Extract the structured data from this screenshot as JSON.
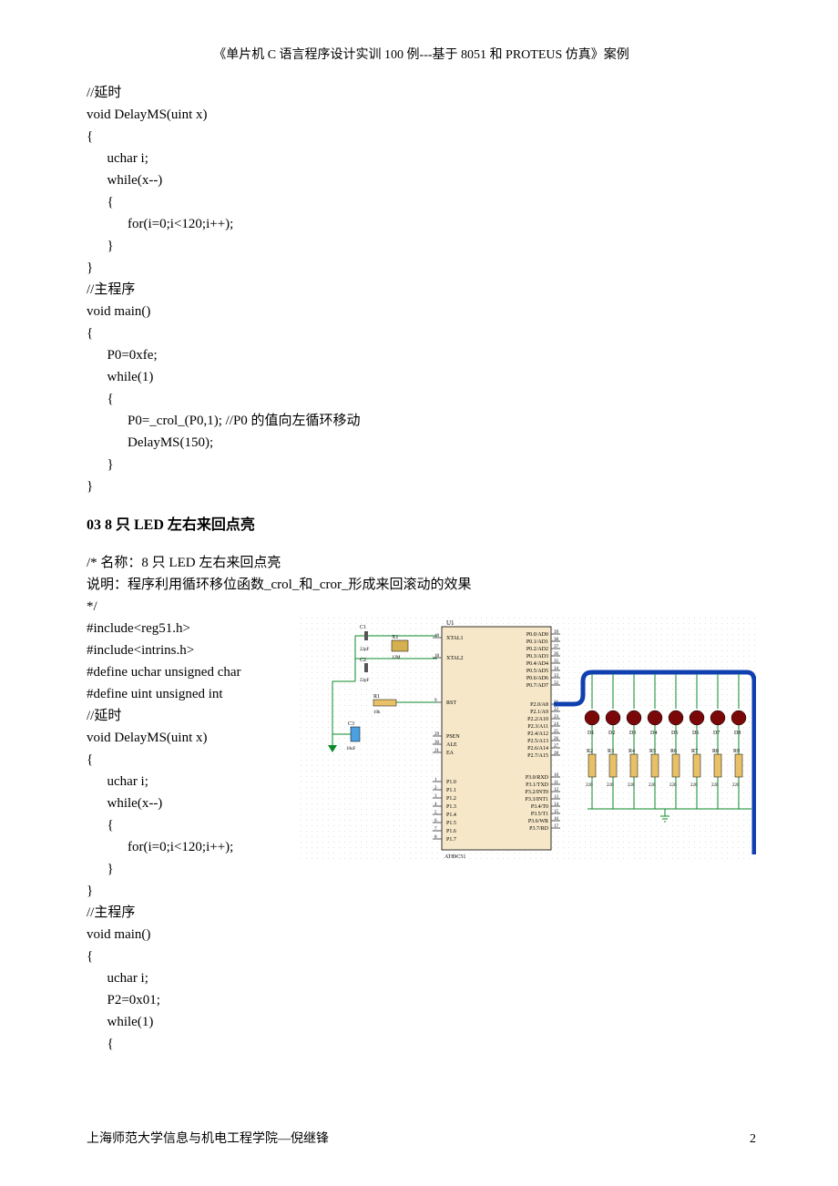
{
  "header": "《单片机 C 语言程序设计实训 100 例---基于 8051 和 PROTEUS 仿真》案例",
  "code_block_1": "//延时\nvoid DelayMS(uint x)\n{\n      uchar i;\n      while(x--)\n      {\n            for(i=0;i<120;i++);\n      }\n}\n//主程序\nvoid main()\n{\n      P0=0xfe;\n      while(1)\n      {\n            P0=_crol_(P0,1); //P0 的值向左循环移动\n            DelayMS(150);\n      }\n}",
  "section_title": "03   8 只 LED 左右来回点亮",
  "desc": {
    "line1": "/*    名称：8 只 LED 左右来回点亮",
    "line2": "      说明：程序利用循环移位函数_crol_和_cror_形成来回滚动的效果",
    "line3": "*/"
  },
  "code_block_2a": "#include<reg51.h>\n#include<intrins.h>\n#define uchar unsigned char\n#define uint unsigned int\n//延时\nvoid DelayMS(uint x)\n{\n      uchar i;\n      while(x--)\n      {\n            for(i=0;i<120;i++);\n      }\n}",
  "code_block_2b": "//主程序\nvoid main()\n{\n      uchar i;\n      P2=0x01;\n      while(1)\n      {",
  "schematic": {
    "caps": {
      "C1": "C1",
      "C2": "C2",
      "C3": "C3",
      "capval": "22pF",
      "c3val": "10uF"
    },
    "crystal": {
      "ref": "X1",
      "val": "12M"
    },
    "res": {
      "R1": "R1",
      "R1val": "10k"
    },
    "chip": {
      "ref": "U1",
      "part": "AT89C51",
      "left_pins": [
        {
          "n": "19",
          "lbl": "XTAL1"
        },
        {
          "n": "18",
          "lbl": "XTAL2"
        },
        {
          "n": "9",
          "lbl": "RST"
        },
        {
          "n": "29",
          "lbl": "PSEN"
        },
        {
          "n": "30",
          "lbl": "ALE"
        },
        {
          "n": "31",
          "lbl": "EA"
        },
        {
          "n": "1",
          "lbl": "P1.0"
        },
        {
          "n": "2",
          "lbl": "P1.1"
        },
        {
          "n": "3",
          "lbl": "P1.2"
        },
        {
          "n": "4",
          "lbl": "P1.3"
        },
        {
          "n": "5",
          "lbl": "P1.4"
        },
        {
          "n": "6",
          "lbl": "P1.5"
        },
        {
          "n": "7",
          "lbl": "P1.6"
        },
        {
          "n": "8",
          "lbl": "P1.7"
        }
      ],
      "right_pins": [
        {
          "lbl": "P0.0/AD0",
          "n": "39"
        },
        {
          "lbl": "P0.1/AD1",
          "n": "38"
        },
        {
          "lbl": "P0.2/AD2",
          "n": "37"
        },
        {
          "lbl": "P0.3/AD3",
          "n": "36"
        },
        {
          "lbl": "P0.4/AD4",
          "n": "35"
        },
        {
          "lbl": "P0.5/AD5",
          "n": "34"
        },
        {
          "lbl": "P0.6/AD6",
          "n": "33"
        },
        {
          "lbl": "P0.7/AD7",
          "n": "32"
        },
        {
          "lbl": "P2.0/A8",
          "n": "21"
        },
        {
          "lbl": "P2.1/A9",
          "n": "22"
        },
        {
          "lbl": "P2.2/A10",
          "n": "23"
        },
        {
          "lbl": "P2.3/A11",
          "n": "24"
        },
        {
          "lbl": "P2.4/A12",
          "n": "25"
        },
        {
          "lbl": "P2.5/A13",
          "n": "26"
        },
        {
          "lbl": "P2.6/A14",
          "n": "27"
        },
        {
          "lbl": "P2.7/A15",
          "n": "28"
        },
        {
          "lbl": "P3.0/RXD",
          "n": "10"
        },
        {
          "lbl": "P3.1/TXD",
          "n": "11"
        },
        {
          "lbl": "P3.2/INT0",
          "n": "12"
        },
        {
          "lbl": "P3.3/INT1",
          "n": "13"
        },
        {
          "lbl": "P3.4/T0",
          "n": "14"
        },
        {
          "lbl": "P3.5/T1",
          "n": "15"
        },
        {
          "lbl": "P3.6/WR",
          "n": "16"
        },
        {
          "lbl": "P3.7/RD",
          "n": "17"
        }
      ]
    },
    "leds": [
      {
        "d": "D1",
        "r": "R2",
        "rv": "220"
      },
      {
        "d": "D2",
        "r": "R3",
        "rv": "220"
      },
      {
        "d": "D3",
        "r": "R4",
        "rv": "220"
      },
      {
        "d": "D4",
        "r": "R5",
        "rv": "220"
      },
      {
        "d": "D5",
        "r": "R6",
        "rv": "220"
      },
      {
        "d": "D6",
        "r": "R7",
        "rv": "220"
      },
      {
        "d": "D7",
        "r": "R8",
        "rv": "220"
      },
      {
        "d": "D8",
        "r": "R9",
        "rv": "220"
      }
    ]
  },
  "footer_left": "上海师范大学信息与机电工程学院—倪继锋",
  "footer_right": "2"
}
